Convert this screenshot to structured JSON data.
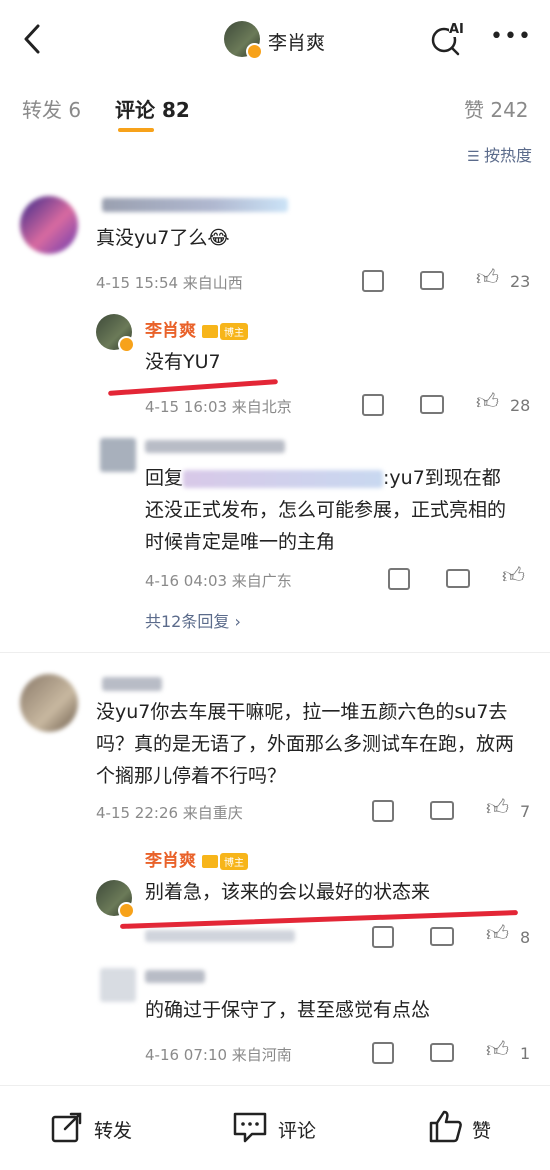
{
  "header": {
    "name": "李肖爽",
    "ai_label": "AI",
    "more": "•••"
  },
  "tabs": {
    "repost": "转发 6",
    "comments": "评论 82",
    "likes": "赞 242"
  },
  "sort": "按热度",
  "comments": [
    {
      "text": "真没yu7了么",
      "emoji": "😂",
      "meta": "4-15 15:54 来自山西",
      "likes": "23",
      "reply": {
        "name": "李肖爽",
        "tag": "博主",
        "text": "没有YU7",
        "meta": "4-15 16:03 来自北京",
        "likes": "28"
      },
      "reply2": {
        "text_prefix": "回复",
        "text": ":yu7到现在都还没正式发布，怎么可能参展，正式亮相的时候肯定是唯一的主角",
        "meta": "4-16 04:03 来自广东"
      },
      "more": "共12条回复 ›"
    },
    {
      "text": "没yu7你去车展干嘛呢，拉一堆五颜六色的su7去吗？真的是无语了，外面那么多测试车在跑，放两个搁那儿停着不行吗？",
      "meta": "4-15 22:26 来自重庆",
      "likes": "7",
      "reply": {
        "name": "李肖爽",
        "tag": "博主",
        "text": "别着急，该来的会以最好的状态来",
        "likes": "8"
      },
      "reply2": {
        "text": "的确过于保守了，甚至感觉有点怂",
        "meta": "4-16 07:10 来自河南",
        "likes": "1"
      }
    }
  ],
  "bottom": {
    "repost": "转发",
    "comment": "评论",
    "like": "赞"
  }
}
